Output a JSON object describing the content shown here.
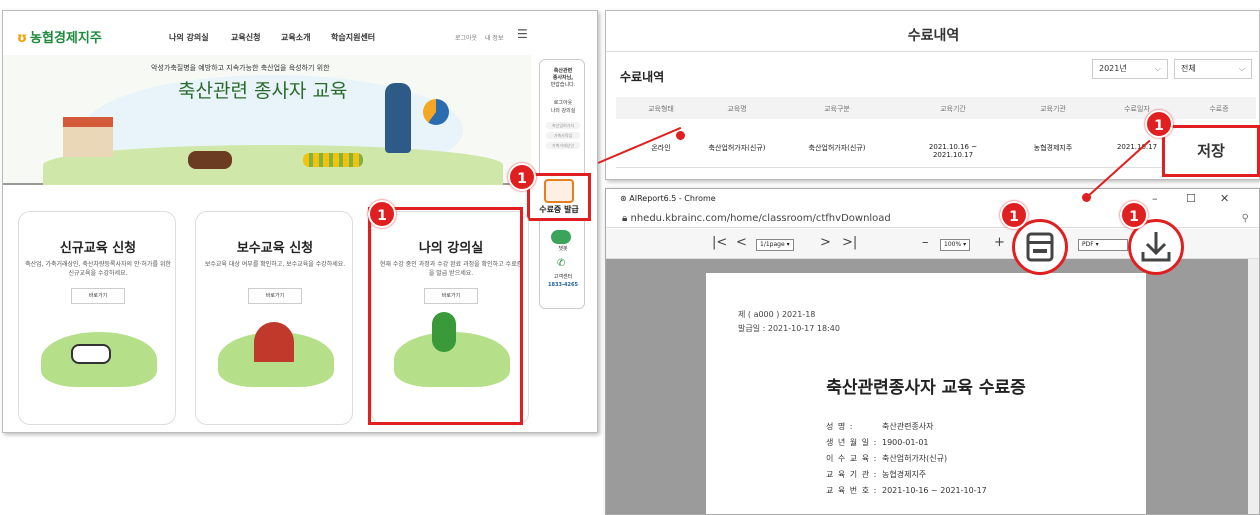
{
  "left_site": {
    "logo": "농협경제지주",
    "nav": [
      "나의 강의실",
      "교육신청",
      "교육소개",
      "학습지원센터"
    ],
    "util_links": [
      "로그아웃",
      "내 정보"
    ],
    "banner_subtitle_pre": "악성가축질병을 예방하고 지속가능한 축산업을 육성하기 위한",
    "banner_title": "축산관련 종사자 교육",
    "sidebar": {
      "greeting": [
        "축산관련",
        "종사자님,",
        "반갑습니다."
      ],
      "links": [
        "로그아웃",
        "나의 강의실"
      ],
      "chips": [
        "축산업허가자",
        "가축사육업",
        "가축거래상인"
      ],
      "cert_label": "수료증 발급",
      "kakao_label": "챗봇",
      "call_label": "고객센터",
      "phone": "1833-4265"
    },
    "cards": [
      {
        "title": "신규교육 신청",
        "desc": "축산업, 가축거래상인, 축산차량등록사자의 안·허가를 위한 신규교육을 수강하세요.",
        "button": "바로가기"
      },
      {
        "title": "보수교육 신청",
        "desc": "보수교육 대상 여부를 확인하고, 보수교육을 수강하세요.",
        "button": "바로가기"
      },
      {
        "title": "나의 강의실",
        "desc": "현재 수강 중인 과정과 수강 완료 과정을 확인하고 수료증을 발급 받으세요.",
        "button": "바로가기"
      }
    ]
  },
  "badges": [
    "1",
    "1",
    "1",
    "1",
    "1"
  ],
  "completion": {
    "title": "수료내역",
    "subtitle": "수료내역",
    "year_select": "2021년",
    "type_select": "전체",
    "headers": [
      "교육형태",
      "교육명",
      "교육구분",
      "교육기간",
      "교육기관",
      "수료일자",
      "수료증"
    ],
    "row": [
      "온라인",
      "축산업허가자(신규)",
      "축산업허가자(신규)",
      "2021.10.16 ~ 2021.10.17",
      "농협경제지주",
      "2021.10.17"
    ],
    "save_label": "저장"
  },
  "chrome": {
    "window_title": "AIReport6.5 - Chrome",
    "url": "nhedu.kbrainc.com/home/classroom/ctfhvDownload",
    "page_select": "1/1page",
    "zoom_select": "100%",
    "format_select": "PDF",
    "doc": {
      "no_line": "제 ( a000 ) 2021-18",
      "issued_line": "발급일 :  2021-10-17 18:40",
      "title": "축산관련종사자 교육 수료증",
      "fields": [
        {
          "k": "성      명 :",
          "v": "축산관련종사자"
        },
        {
          "k": "생 년 월 일 :",
          "v": "1900-01-01"
        },
        {
          "k": "이 수 교 육 :",
          "v": "축산업허가자(신규)"
        },
        {
          "k": "교 육 기 관 :",
          "v": "농협경제지주"
        },
        {
          "k": "교 육 번 호 :",
          "v": "2021-10-16 ~ 2021-10-17"
        }
      ]
    }
  },
  "colors": {
    "accent_red": "#e02020",
    "brand_green": "#1f8a3c",
    "orange": "#e06010"
  }
}
